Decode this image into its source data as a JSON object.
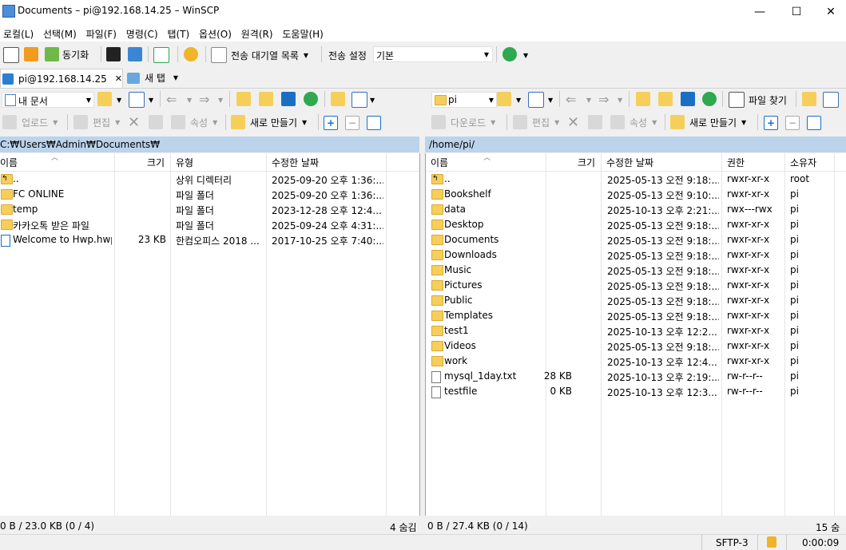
{
  "window": {
    "title": "Documents – pi@192.168.14.25 – WinSCP",
    "min": "—",
    "max": "☐",
    "close": "✕"
  },
  "menu": [
    "로컬(L)",
    "선택(M)",
    "파일(F)",
    "명령(C)",
    "탭(T)",
    "옵션(O)",
    "원격(R)",
    "도움말(H)"
  ],
  "toolbar": {
    "sync": "동기화",
    "queue": "전송 대기열 목록",
    "transfer_settings": "전송 설정",
    "transfer_mode": "기본"
  },
  "tabs": {
    "session": "pi@192.168.14.25",
    "close": "✕",
    "new_tab": "새 탭"
  },
  "left": {
    "location": "내 문서",
    "upload": "업로드",
    "edit": "편집",
    "props": "속성",
    "new": "새로 만들기",
    "path": "C:₩Users₩Admin₩Documents₩",
    "headers": {
      "name": "이름",
      "size": "크기",
      "type": "유형",
      "modified": "수정한 날짜"
    },
    "files": [
      {
        "name": "..",
        "size": "",
        "type": "상위 디렉터리",
        "modified": "2025-09-20 오후 1:36:...",
        "icon": "parent"
      },
      {
        "name": "FC ONLINE",
        "size": "",
        "type": "파일 폴더",
        "modified": "2025-09-20 오후 1:36:...",
        "icon": "folder"
      },
      {
        "name": "temp",
        "size": "",
        "type": "파일 폴더",
        "modified": "2023-12-28 오후 12:4...",
        "icon": "folder"
      },
      {
        "name": "카카오톡 받은 파일",
        "size": "",
        "type": "파일 폴더",
        "modified": "2025-09-24 오후 4:31:...",
        "icon": "folder"
      },
      {
        "name": "Welcome to Hwp.hwp",
        "size": "23 KB",
        "type": "한컴오피스 2018 ...",
        "modified": "2017-10-25 오후 7:40:...",
        "icon": "hwp"
      }
    ],
    "status": "0 B / 23.0 KB (0 / 4)",
    "hidden": "4 숨김"
  },
  "right": {
    "location": "pi",
    "download": "다운로드",
    "edit": "편집",
    "props": "속성",
    "new": "새로 만들기",
    "find": "파일 찾기",
    "path": "/home/pi/",
    "headers": {
      "name": "이름",
      "size": "크기",
      "modified": "수정한 날짜",
      "rights": "권한",
      "owner": "소유자"
    },
    "files": [
      {
        "name": "..",
        "size": "",
        "modified": "2025-05-13 오전 9:18:...",
        "rights": "rwxr-xr-x",
        "owner": "root",
        "icon": "parent"
      },
      {
        "name": "Bookshelf",
        "size": "",
        "modified": "2025-05-13 오전 9:10:...",
        "rights": "rwxr-xr-x",
        "owner": "pi",
        "icon": "folder"
      },
      {
        "name": "data",
        "size": "",
        "modified": "2025-10-13 오후 2:21:...",
        "rights": "rwx---rwx",
        "owner": "pi",
        "icon": "folder"
      },
      {
        "name": "Desktop",
        "size": "",
        "modified": "2025-05-13 오전 9:18:...",
        "rights": "rwxr-xr-x",
        "owner": "pi",
        "icon": "folder"
      },
      {
        "name": "Documents",
        "size": "",
        "modified": "2025-05-13 오전 9:18:...",
        "rights": "rwxr-xr-x",
        "owner": "pi",
        "icon": "folder"
      },
      {
        "name": "Downloads",
        "size": "",
        "modified": "2025-05-13 오전 9:18:...",
        "rights": "rwxr-xr-x",
        "owner": "pi",
        "icon": "folder"
      },
      {
        "name": "Music",
        "size": "",
        "modified": "2025-05-13 오전 9:18:...",
        "rights": "rwxr-xr-x",
        "owner": "pi",
        "icon": "folder"
      },
      {
        "name": "Pictures",
        "size": "",
        "modified": "2025-05-13 오전 9:18:...",
        "rights": "rwxr-xr-x",
        "owner": "pi",
        "icon": "folder"
      },
      {
        "name": "Public",
        "size": "",
        "modified": "2025-05-13 오전 9:18:...",
        "rights": "rwxr-xr-x",
        "owner": "pi",
        "icon": "folder"
      },
      {
        "name": "Templates",
        "size": "",
        "modified": "2025-05-13 오전 9:18:...",
        "rights": "rwxr-xr-x",
        "owner": "pi",
        "icon": "folder"
      },
      {
        "name": "test1",
        "size": "",
        "modified": "2025-10-13 오후 12:2...",
        "rights": "rwxr-xr-x",
        "owner": "pi",
        "icon": "folder"
      },
      {
        "name": "Videos",
        "size": "",
        "modified": "2025-05-13 오전 9:18:...",
        "rights": "rwxr-xr-x",
        "owner": "pi",
        "icon": "folder"
      },
      {
        "name": "work",
        "size": "",
        "modified": "2025-10-13 오후 12:4...",
        "rights": "rwxr-xr-x",
        "owner": "pi",
        "icon": "folder"
      },
      {
        "name": "mysql_1day.txt",
        "size": "28 KB",
        "modified": "2025-10-13 오후 2:19:...",
        "rights": "rw-r--r--",
        "owner": "pi",
        "icon": "text"
      },
      {
        "name": "testfile",
        "size": "0 KB",
        "modified": "2025-10-13 오후 12:3...",
        "rights": "rw-r--r--",
        "owner": "pi",
        "icon": "file"
      }
    ],
    "status": "0 B / 27.4 KB (0 / 14)",
    "hidden": "15 숨김"
  },
  "statusbar": {
    "protocol": "SFTP-3",
    "time": "0:00:09"
  },
  "colors": {
    "path_bar": "#bcd3ec",
    "folder": "#f6cf5b",
    "accent_green": "#2fa84f",
    "accent_blue": "#1a6fc4"
  }
}
